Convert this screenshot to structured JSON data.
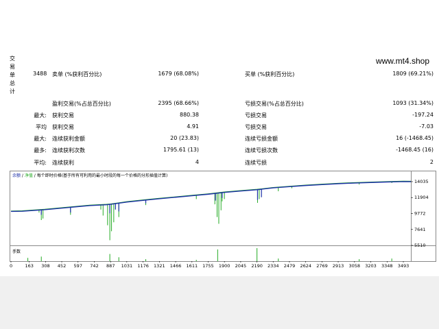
{
  "site": "www.mt4.shop",
  "side_label": [
    "交",
    "易",
    "单",
    "总",
    "计"
  ],
  "rows": [
    {
      "c1_label": "",
      "c1_value": "3488",
      "c2_label": "卖单 (%获利百分比)",
      "c2_value": "1679 (68.08%)",
      "c3_label": "买单 (%获利百分比)",
      "c3_value": "1809 (69.21%)"
    },
    {
      "c1_label": "",
      "c1_value": "",
      "c2_label": "盈利交易(%占总百分比)",
      "c2_value": "2395 (68.66%)",
      "c3_label": "亏损交易(%占总百分比)",
      "c3_value": "1093 (31.34%)"
    },
    {
      "c1_label": "最大:",
      "c1_value": "",
      "c2_label": "获利交易",
      "c2_value": "880.38",
      "c3_label": "亏损交易",
      "c3_value": "-197.24"
    },
    {
      "c1_label": "平均",
      "c1_value": "",
      "c2_label": "获利交易",
      "c2_value": "4.91",
      "c3_label": "亏损交易",
      "c3_value": "-7.03"
    },
    {
      "c1_label": "最大:",
      "c1_value": "",
      "c2_label": "连续获利金额",
      "c2_value": "20 (23.83)",
      "c3_label": "连续亏损金额",
      "c3_value": "16 (-1468.45)"
    },
    {
      "c1_label": "最多:",
      "c1_value": "",
      "c2_label": "连续获利次数",
      "c2_value": "1795.61 (13)",
      "c3_label": "连续亏损次数",
      "c3_value": "-1468.45 (16)"
    },
    {
      "c1_label": "平均:",
      "c1_value": "",
      "c2_label": "连续获利",
      "c2_value": "4",
      "c3_label": "连续亏损",
      "c3_value": "2"
    }
  ],
  "chart": {
    "legend_balance": "余额",
    "legend_equity": "净值",
    "legend_text": "每个即时价格(基于所有可利用的最小时段的每一个价格的分形插值计算)",
    "volume_label": "手数",
    "colors": {
      "balance": "#1c2fa8",
      "equity": "#22aa22",
      "volume": "#22aa22",
      "frame": "#888888"
    }
  },
  "chart_data": {
    "type": "line",
    "series": [
      {
        "name": "余额",
        "values_desc": "balance"
      },
      {
        "name": "净值",
        "values_desc": "equity"
      }
    ],
    "y_ticks": [
      14035,
      11904,
      9772,
      7641,
      5510
    ],
    "ylim": [
      5510,
      14035
    ],
    "x_ticks": [
      0,
      163,
      308,
      452,
      597,
      742,
      887,
      1031,
      1176,
      1321,
      1466,
      1611,
      1755,
      1900,
      2045,
      2190,
      2334,
      2479,
      2624,
      2769,
      2913,
      3058,
      3203,
      3348,
      3493
    ],
    "xlim": [
      0,
      3560
    ],
    "balance": [
      [
        0,
        10050
      ],
      [
        100,
        10080
      ],
      [
        200,
        10180
      ],
      [
        300,
        10280
      ],
      [
        400,
        10420
      ],
      [
        500,
        10560
      ],
      [
        600,
        10700
      ],
      [
        700,
        10830
      ],
      [
        850,
        10950
      ],
      [
        887,
        11000
      ],
      [
        960,
        11150
      ],
      [
        1031,
        11300
      ],
      [
        1176,
        11530
      ],
      [
        1321,
        11750
      ],
      [
        1466,
        11950
      ],
      [
        1611,
        12150
      ],
      [
        1755,
        12350
      ],
      [
        1900,
        12600
      ],
      [
        2045,
        12780
      ],
      [
        2190,
        12950
      ],
      [
        2334,
        13200
      ],
      [
        2479,
        13360
      ],
      [
        2624,
        13520
      ],
      [
        2769,
        13640
      ],
      [
        2913,
        13760
      ],
      [
        3058,
        13850
      ],
      [
        3203,
        13920
      ],
      [
        3348,
        13990
      ],
      [
        3493,
        14040
      ],
      [
        3560,
        14035
      ]
    ],
    "balance_dips": [
      [
        270,
        9600
      ],
      [
        530,
        9900
      ],
      [
        880,
        9800
      ],
      [
        930,
        10300
      ],
      [
        960,
        10050
      ],
      [
        1200,
        11150
      ],
      [
        1820,
        11500
      ],
      [
        1880,
        11850
      ],
      [
        2195,
        11600
      ],
      [
        2230,
        11950
      ]
    ],
    "equity_dips": [
      [
        250,
        9900
      ],
      [
        270,
        8900
      ],
      [
        285,
        9100
      ],
      [
        530,
        9600
      ],
      [
        800,
        10300
      ],
      [
        820,
        9500
      ],
      [
        860,
        8200
      ],
      [
        880,
        6200
      ],
      [
        895,
        7400
      ],
      [
        915,
        8600
      ],
      [
        960,
        9300
      ],
      [
        1200,
        10900
      ],
      [
        1650,
        11700
      ],
      [
        1815,
        11000
      ],
      [
        1835,
        9300
      ],
      [
        1850,
        8400
      ],
      [
        1870,
        10200
      ],
      [
        1880,
        11400
      ],
      [
        1900,
        11700
      ],
      [
        2195,
        11200
      ],
      [
        2210,
        11700
      ],
      [
        2380,
        12750
      ],
      [
        2500,
        13150
      ],
      [
        3100,
        13650
      ],
      [
        3390,
        13850
      ]
    ],
    "volume_bars": [
      [
        150,
        0.25
      ],
      [
        270,
        0.35
      ],
      [
        880,
        0.55
      ],
      [
        960,
        0.3
      ],
      [
        1200,
        0.15
      ],
      [
        1650,
        0.1
      ],
      [
        1840,
        0.9
      ],
      [
        2190,
        1.0
      ],
      [
        2380,
        0.2
      ],
      [
        3100,
        0.15
      ],
      [
        3390,
        0.2
      ]
    ]
  }
}
